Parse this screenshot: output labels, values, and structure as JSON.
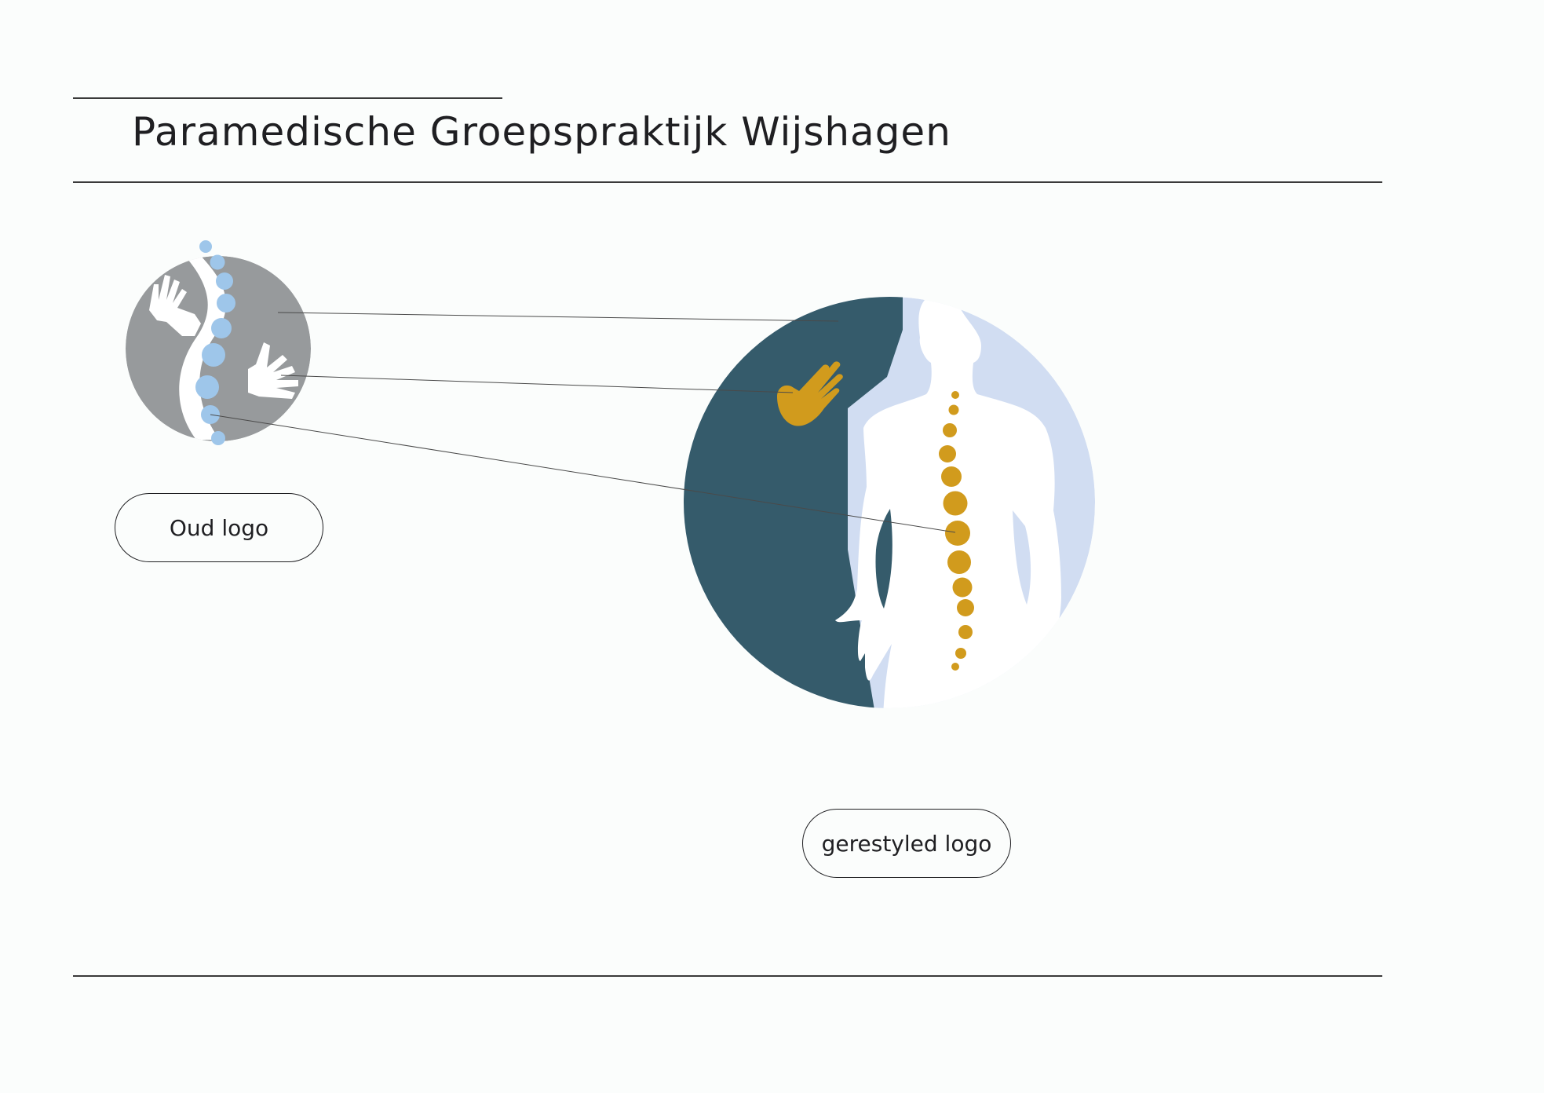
{
  "header": {
    "title": "Paramedische Groepspraktijk Wijshagen"
  },
  "labels": {
    "old_logo": "Oud logo",
    "new_logo": "gerestyled logo"
  },
  "colors": {
    "old_circle": "#979a9c",
    "old_vertebrae": "#9ec6ea",
    "new_circle_dark": "#355b6b",
    "new_circle_light": "#d1ddf2",
    "new_accent": "#d19b1d",
    "silhouette": "#ffffff",
    "rules": "#3a3a3a"
  }
}
